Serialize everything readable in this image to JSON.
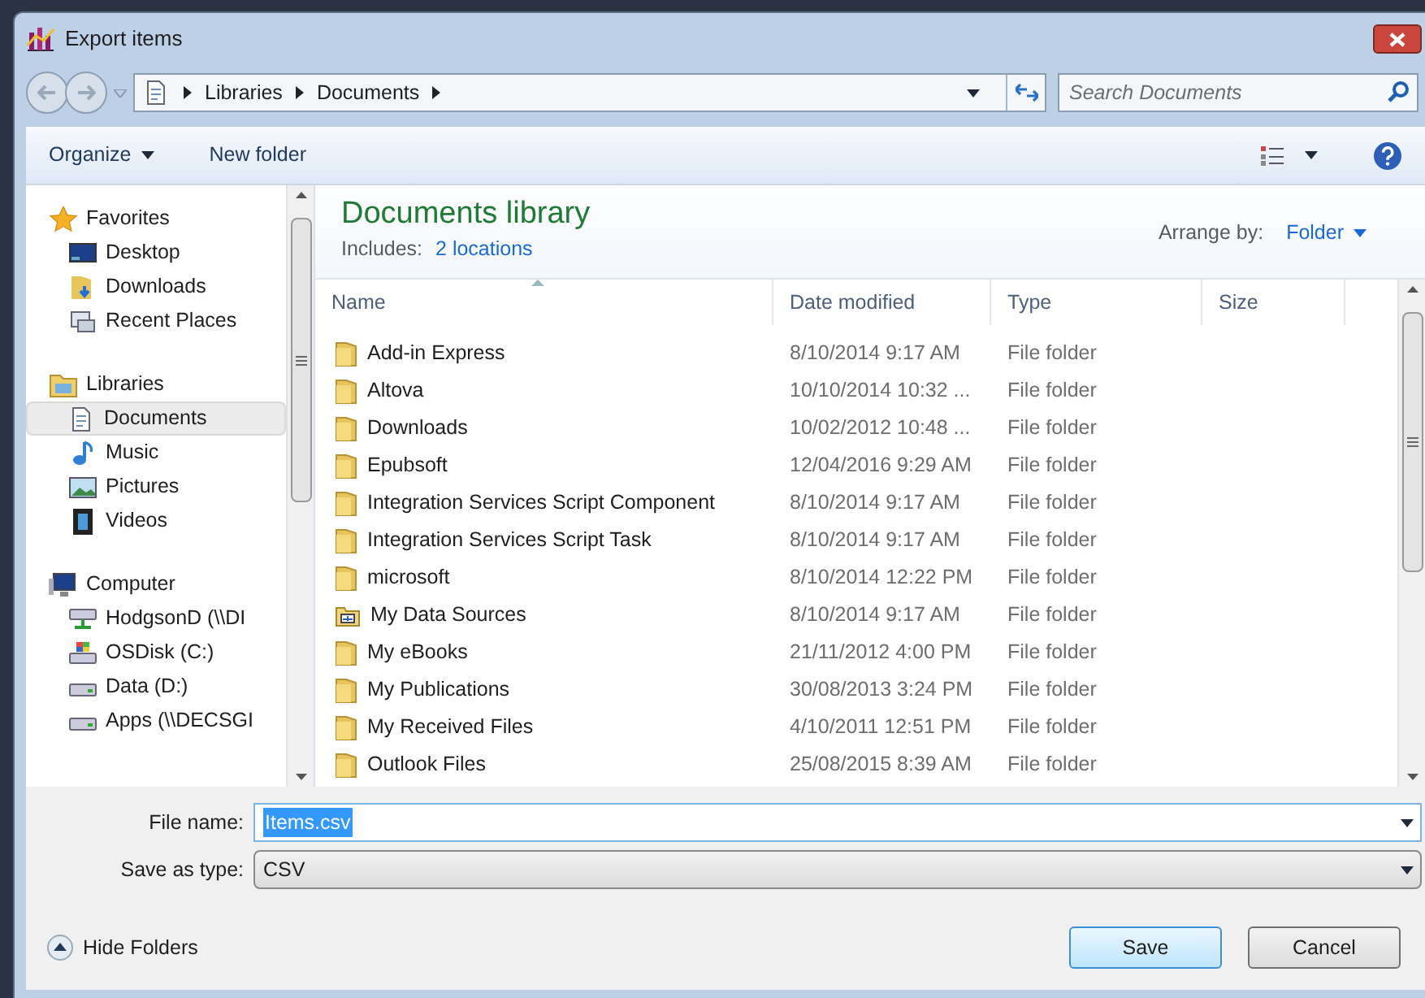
{
  "window": {
    "title": "Export items"
  },
  "address_bar": {
    "path": [
      "Libraries",
      "Documents"
    ]
  },
  "search": {
    "placeholder": "Search Documents"
  },
  "toolbar": {
    "organize": "Organize",
    "new_folder": "New folder"
  },
  "sidebar": {
    "groups": [
      {
        "label": "Favorites",
        "kind": "favorites",
        "children": [
          {
            "label": "Desktop",
            "kind": "desktop",
            "selected": false
          },
          {
            "label": "Downloads",
            "kind": "downloads",
            "selected": false
          },
          {
            "label": "Recent Places",
            "kind": "recent",
            "selected": false
          }
        ]
      },
      {
        "label": "Libraries",
        "kind": "libraries",
        "children": [
          {
            "label": "Documents",
            "kind": "documents",
            "selected": true
          },
          {
            "label": "Music",
            "kind": "music",
            "selected": false
          },
          {
            "label": "Pictures",
            "kind": "pictures",
            "selected": false
          },
          {
            "label": "Videos",
            "kind": "videos",
            "selected": false
          }
        ]
      },
      {
        "label": "Computer",
        "kind": "computer",
        "children": [
          {
            "label": "HodgsonD (\\\\DI",
            "kind": "network",
            "selected": false
          },
          {
            "label": "OSDisk (C:)",
            "kind": "osdisk",
            "selected": false
          },
          {
            "label": "Data (D:)",
            "kind": "drive",
            "selected": false
          },
          {
            "label": "Apps (\\\\DECSGI",
            "kind": "drive",
            "selected": false
          }
        ]
      }
    ]
  },
  "library": {
    "title": "Documents library",
    "includes_label": "Includes:",
    "includes_link": "2 locations",
    "arrange_label": "Arrange by:",
    "arrange_value": "Folder"
  },
  "table": {
    "columns": [
      {
        "label": "Name",
        "sorted": true
      },
      {
        "label": "Date modified",
        "sorted": false
      },
      {
        "label": "Type",
        "sorted": false
      },
      {
        "label": "Size",
        "sorted": false
      }
    ],
    "rows": [
      {
        "name": "Add-in Express",
        "date": "8/10/2014 9:17 AM",
        "type": "File folder",
        "kind": "folder"
      },
      {
        "name": "Altova",
        "date": "10/10/2014 10:32 ...",
        "type": "File folder",
        "kind": "folder"
      },
      {
        "name": "Downloads",
        "date": "10/02/2012 10:48 ...",
        "type": "File folder",
        "kind": "folder"
      },
      {
        "name": "Epubsoft",
        "date": "12/04/2016 9:29 AM",
        "type": "File folder",
        "kind": "folder"
      },
      {
        "name": "Integration Services Script Component",
        "date": "8/10/2014 9:17 AM",
        "type": "File folder",
        "kind": "folder"
      },
      {
        "name": "Integration Services Script Task",
        "date": "8/10/2014 9:17 AM",
        "type": "File folder",
        "kind": "folder"
      },
      {
        "name": "microsoft",
        "date": "8/10/2014 12:22 PM",
        "type": "File folder",
        "kind": "folder"
      },
      {
        "name": "My Data Sources",
        "date": "8/10/2014 9:17 AM",
        "type": "File folder",
        "kind": "data-folder"
      },
      {
        "name": "My eBooks",
        "date": "21/11/2012 4:00 PM",
        "type": "File folder",
        "kind": "folder"
      },
      {
        "name": "My Publications",
        "date": "30/08/2013 3:24 PM",
        "type": "File folder",
        "kind": "folder"
      },
      {
        "name": "My Received Files",
        "date": "4/10/2011 12:51 PM",
        "type": "File folder",
        "kind": "folder"
      },
      {
        "name": "Outlook Files",
        "date": "25/08/2015 8:39 AM",
        "type": "File folder",
        "kind": "folder"
      }
    ]
  },
  "file_name": {
    "label": "File name:",
    "value": "Items.csv"
  },
  "save_type": {
    "label": "Save as type:",
    "value": "CSV"
  },
  "hide_folders": "Hide Folders",
  "buttons": [
    {
      "label": "Save",
      "default": true
    },
    {
      "label": "Cancel",
      "default": false
    }
  ]
}
